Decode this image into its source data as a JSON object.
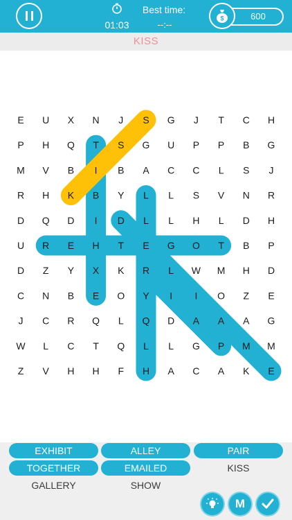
{
  "header": {
    "timer": "01:03",
    "best_time_label": "Best time:",
    "best_time_value": "--:--",
    "coins": "600"
  },
  "current_word": "KISS",
  "grid": [
    [
      "E",
      "U",
      "X",
      "N",
      "J",
      "S",
      "G",
      "J",
      "T",
      "C",
      "H"
    ],
    [
      "P",
      "H",
      "Q",
      "T",
      "S",
      "G",
      "U",
      "P",
      "P",
      "B",
      "G"
    ],
    [
      "M",
      "V",
      "B",
      "I",
      "B",
      "A",
      "C",
      "C",
      "L",
      "S",
      "J"
    ],
    [
      "R",
      "H",
      "K",
      "B",
      "Y",
      "L",
      "L",
      "S",
      "V",
      "N",
      "R"
    ],
    [
      "D",
      "Q",
      "D",
      "I",
      "D",
      "L",
      "L",
      "H",
      "L",
      "D",
      "H"
    ],
    [
      "U",
      "R",
      "E",
      "H",
      "T",
      "E",
      "G",
      "O",
      "T",
      "B",
      "P"
    ],
    [
      "D",
      "Z",
      "Y",
      "X",
      "K",
      "R",
      "L",
      "W",
      "M",
      "H",
      "D"
    ],
    [
      "C",
      "N",
      "B",
      "E",
      "O",
      "Y",
      "I",
      "I",
      "O",
      "Z",
      "E"
    ],
    [
      "J",
      "C",
      "R",
      "Q",
      "L",
      "Q",
      "D",
      "A",
      "A",
      "A",
      "G"
    ],
    [
      "W",
      "L",
      "C",
      "T",
      "Q",
      "L",
      "L",
      "G",
      "P",
      "M",
      "M"
    ],
    [
      "Z",
      "V",
      "H",
      "H",
      "F",
      "H",
      "A",
      "C",
      "A",
      "K",
      "E"
    ]
  ],
  "found_highlights": [
    {
      "word": "EXHIBIT",
      "from": [
        7,
        3
      ],
      "to": [
        1,
        3
      ],
      "color": "#22b0d3"
    },
    {
      "word": "TOGETHER",
      "from": [
        5,
        8
      ],
      "to": [
        5,
        1
      ],
      "color": "#22b0d3"
    },
    {
      "word": "ALLEY",
      "from": [
        4,
        4
      ],
      "to": [
        10,
        10
      ],
      "color": "#22b0d3"
    },
    {
      "word": "PAIR",
      "from": [
        9,
        8
      ],
      "to": [
        6,
        5
      ],
      "color": "#22b0d3"
    },
    {
      "word": "EMAILED",
      "from": [
        3,
        5
      ],
      "to": [
        10,
        5
      ],
      "color": "#22b0d3"
    },
    {
      "word": "KISS",
      "from": [
        3,
        2
      ],
      "to": [
        0,
        5
      ],
      "color": "#ffc107"
    }
  ],
  "words": [
    {
      "label": "EXHIBIT",
      "found": true
    },
    {
      "label": "ALLEY",
      "found": true
    },
    {
      "label": "PAIR",
      "found": true
    },
    {
      "label": "TOGETHER",
      "found": true
    },
    {
      "label": "EMAILED",
      "found": true
    },
    {
      "label": "KISS",
      "found": false
    },
    {
      "label": "GALLERY",
      "found": false
    },
    {
      "label": "SHOW",
      "found": false
    }
  ],
  "buttons": {
    "hint_icon": "lightbulb-icon",
    "m_label": "M",
    "check_icon": "check-icon"
  },
  "colors": {
    "accent": "#22b0d3",
    "current_word": "#f28d95",
    "selection": "#ffc107"
  }
}
